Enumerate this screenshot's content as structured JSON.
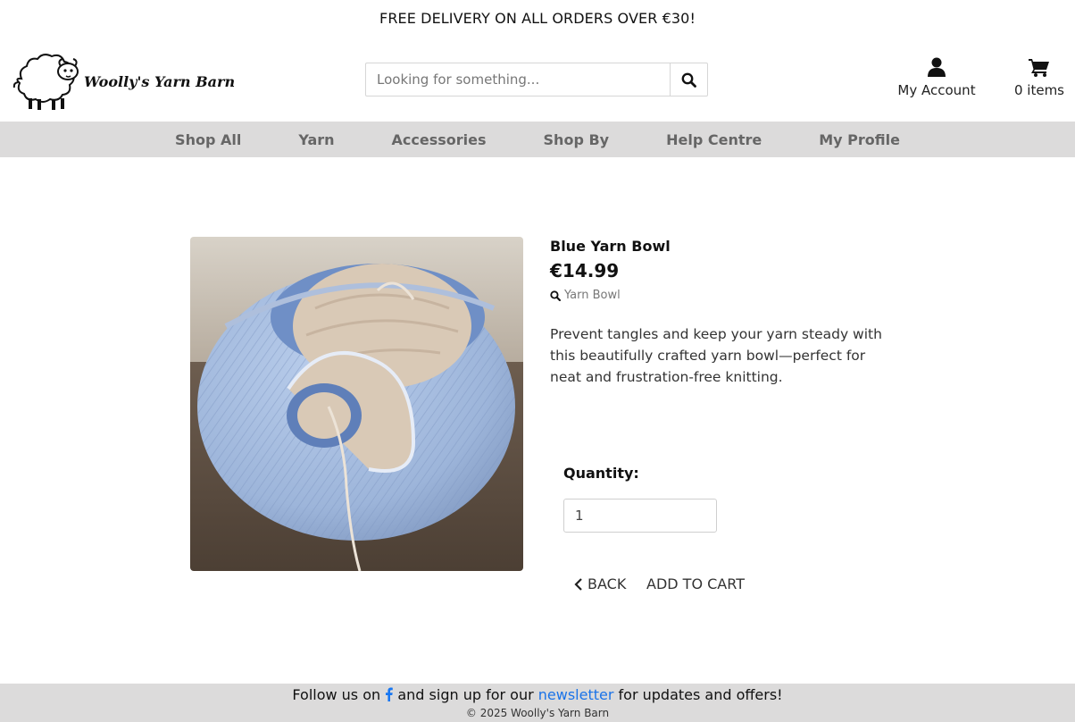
{
  "promo": {
    "text": "FREE DELIVERY ON ALL ORDERS OVER €30!"
  },
  "header": {
    "logo_text": "Woolly's Yarn Barn",
    "search_placeholder": "Looking for something...",
    "account_label": "My Account",
    "cart_label": "0 items"
  },
  "nav": {
    "items": [
      "Shop All",
      "Yarn",
      "Accessories",
      "Shop By",
      "Help Centre",
      "My Profile"
    ]
  },
  "product": {
    "name": "Blue Yarn Bowl",
    "price": "€14.99",
    "category": "Yarn Bowl",
    "description": "Prevent tangles and keep your yarn steady with this beautifully crafted yarn bowl—perfect for neat and frustration-free knitting.",
    "quantity_label": "Quantity:",
    "quantity_value": "1",
    "back_label": "BACK",
    "add_to_cart_label": "ADD TO CART"
  },
  "footer": {
    "follow_prefix": "Follow us on",
    "follow_middle": "and sign up for our",
    "newsletter_link": "newsletter",
    "follow_suffix": "for updates and offers!",
    "copyright": "© 2025 Woolly's Yarn Barn"
  },
  "colors": {
    "nav_bg": "#dcdbdb",
    "footer_bg": "#dcdbdb",
    "link_blue": "#1a73e8",
    "facebook_blue": "#1877f2",
    "bowl_blue": "#9fb8dd"
  }
}
